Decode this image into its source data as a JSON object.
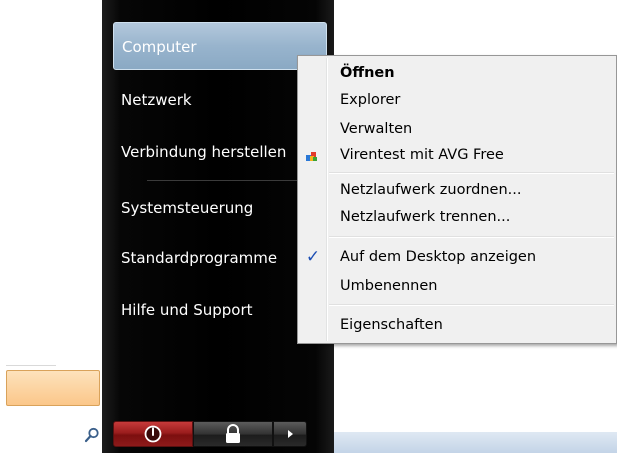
{
  "start_menu": {
    "right_pane": {
      "items": [
        {
          "label": "Computer"
        },
        {
          "label": "Netzwerk"
        },
        {
          "label": "Verbindung herstellen"
        },
        {
          "label": "Systemsteuerung"
        },
        {
          "label": "Standardprogramme"
        },
        {
          "label": "Hilfe und Support"
        }
      ],
      "selected": "Computer"
    },
    "icons": {
      "search": "search-icon",
      "power": "power-icon",
      "lock": "lock-icon",
      "arrow": "arrow-right-icon"
    }
  },
  "context_menu": {
    "items": [
      {
        "label": "Öffnen",
        "bold": true
      },
      {
        "label": "Explorer"
      },
      {
        "label": "Verwalten"
      },
      {
        "label": "Virentest mit AVG Free",
        "icon": "avg-icon"
      },
      {
        "label": "Netzlaufwerk zuordnen..."
      },
      {
        "label": "Netzlaufwerk trennen..."
      },
      {
        "label": "Auf dem Desktop anzeigen",
        "checked": true
      },
      {
        "label": "Umbenennen"
      },
      {
        "label": "Eigenschaften"
      }
    ]
  },
  "colors": {
    "accent": "#1e4fb4",
    "power_red": "#9b1d1d",
    "highlight": "#fbc78a"
  }
}
